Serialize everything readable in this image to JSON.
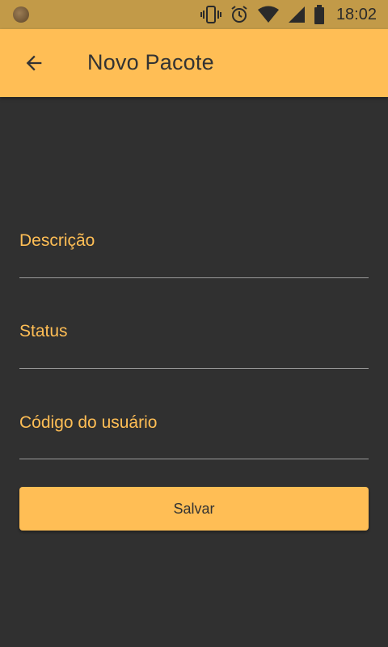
{
  "status_bar": {
    "time": "18:02",
    "icons": [
      "vibrate-icon",
      "alarm-icon",
      "wifi-icon",
      "signal-icon",
      "battery-icon"
    ]
  },
  "app_bar": {
    "title": "Novo Pacote",
    "back_icon": "arrow-left-icon"
  },
  "form": {
    "fields": [
      {
        "label": "Descrição",
        "value": ""
      },
      {
        "label": "Status",
        "value": ""
      },
      {
        "label": "Código do usuário",
        "value": ""
      }
    ],
    "save_label": "Salvar"
  },
  "colors": {
    "accent": "#ffbe55",
    "status_bar": "#c29a48",
    "background": "#303030"
  }
}
